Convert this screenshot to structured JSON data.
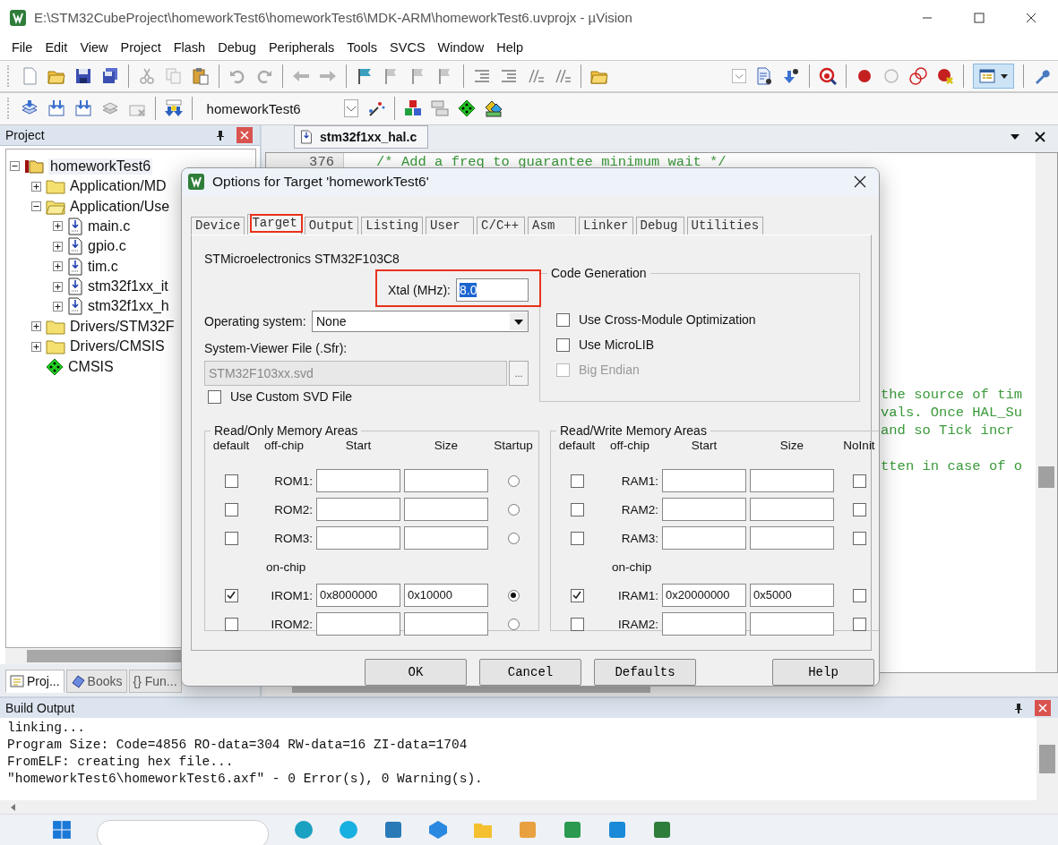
{
  "window": {
    "title": "E:\\STM32CubeProject\\homeworkTest6\\homeworkTest6\\MDK-ARM\\homeworkTest6.uvprojx - µVision"
  },
  "menu": [
    "File",
    "Edit",
    "View",
    "Project",
    "Flash",
    "Debug",
    "Peripherals",
    "Tools",
    "SVCS",
    "Window",
    "Help"
  ],
  "target_select": {
    "value": "homeworkTest6"
  },
  "project": {
    "title": "Project",
    "tree": [
      {
        "label": "homeworkTest6",
        "kind": "project",
        "expanded": true,
        "selected": true,
        "children": [
          {
            "label": "Application/MD",
            "kind": "folder",
            "expanded": false,
            "selected": false
          },
          {
            "label": "Application/Use",
            "kind": "folder",
            "expanded": true,
            "selected": false,
            "children": [
              {
                "label": "main.c",
                "kind": "file",
                "expanded": false,
                "selected": false
              },
              {
                "label": "gpio.c",
                "kind": "file",
                "expanded": false,
                "selected": false
              },
              {
                "label": "tim.c",
                "kind": "file",
                "expanded": false,
                "selected": false
              },
              {
                "label": "stm32f1xx_it",
                "kind": "file",
                "expanded": false,
                "selected": false
              },
              {
                "label": "stm32f1xx_h",
                "kind": "file",
                "expanded": false,
                "selected": false
              }
            ]
          },
          {
            "label": "Drivers/STM32F",
            "kind": "folder",
            "expanded": false,
            "selected": false
          },
          {
            "label": "Drivers/CMSIS",
            "kind": "folder",
            "expanded": false,
            "selected": false
          },
          {
            "label": "CMSIS",
            "kind": "component",
            "selected": false
          }
        ]
      }
    ],
    "tabs": [
      {
        "label": "Proj...",
        "kind": "project",
        "selected": true
      },
      {
        "label": "Books",
        "kind": "books",
        "selected": false
      },
      {
        "label": "{} Fun...",
        "kind": "functions",
        "selected": false
      }
    ]
  },
  "editor": {
    "tabs": [
      {
        "label": "stm32f1xx_hal.c",
        "selected": true
      }
    ],
    "lines": [
      {
        "number": "376",
        "code": "/* Add a freq to guarantee minimum wait */"
      }
    ],
    "fragments": [
      [
        "the source of tim",
        "vals. Once HAL_Su",
        "and so Tick incr"
      ],
      [
        "tten in case of o"
      ]
    ]
  },
  "dialog": {
    "title": "Options for Target 'homeworkTest6'",
    "tabs": [
      {
        "label": "Device",
        "selected": false,
        "highlight": false
      },
      {
        "label": "Target",
        "selected": true,
        "highlight": true
      },
      {
        "label": "Output",
        "selected": false,
        "highlight": false
      },
      {
        "label": "Listing",
        "selected": false,
        "highlight": false
      },
      {
        "label": "User",
        "selected": false,
        "highlight": false
      },
      {
        "label": "C/C++",
        "selected": false,
        "highlight": false
      },
      {
        "label": "Asm",
        "selected": false,
        "highlight": false
      },
      {
        "label": "Linker",
        "selected": false,
        "highlight": false
      },
      {
        "label": "Debug",
        "selected": false,
        "highlight": false
      },
      {
        "label": "Utilities",
        "selected": false,
        "highlight": false
      }
    ],
    "device": "STMicroelectronics STM32F103C8",
    "xtal": {
      "label": "Xtal (MHz):",
      "value": "8.0",
      "highlight": true
    },
    "os": {
      "label": "Operating system:",
      "value": "None"
    },
    "svd": {
      "label": "System-Viewer File (.Sfr):",
      "value": "STM32F103xx.svd",
      "browse": "...",
      "disabled": true
    },
    "custom_svd": {
      "label": "Use Custom SVD File",
      "checked": false
    },
    "code_generation": {
      "title": "Code Generation",
      "options": [
        {
          "label": "Use Cross-Module Optimization",
          "checked": false,
          "disabled": false
        },
        {
          "label": "Use MicroLIB",
          "checked": false,
          "disabled": false
        },
        {
          "label": "Big Endian",
          "checked": false,
          "disabled": true
        }
      ]
    },
    "memory": [
      {
        "title": "Read/Only Memory Areas",
        "headers": [
          "default",
          "off-chip",
          "Start",
          "Size",
          "Startup"
        ],
        "kind": "radio",
        "onchip_label": "on-chip",
        "offchip": [
          {
            "label": "ROM1:",
            "default": false,
            "last": false
          },
          {
            "label": "ROM2:",
            "default": false,
            "last": false
          },
          {
            "label": "ROM3:",
            "default": false,
            "last": false
          }
        ],
        "onchip": [
          {
            "label": "IROM1:",
            "default": true,
            "start": "0x8000000",
            "size": "0x10000",
            "last": true
          },
          {
            "label": "IROM2:",
            "default": false,
            "last": false
          }
        ]
      },
      {
        "title": "Read/Write Memory Areas",
        "headers": [
          "default",
          "off-chip",
          "Start",
          "Size",
          "NoInit"
        ],
        "kind": "checkbox",
        "onchip_label": "on-chip",
        "offchip": [
          {
            "label": "RAM1:",
            "default": false,
            "last": false
          },
          {
            "label": "RAM2:",
            "default": false,
            "last": false
          },
          {
            "label": "RAM3:",
            "default": false,
            "last": false
          }
        ],
        "onchip": [
          {
            "label": "IRAM1:",
            "default": true,
            "start": "0x20000000",
            "size": "0x5000",
            "last": false
          },
          {
            "label": "IRAM2:",
            "default": false,
            "last": false
          }
        ]
      }
    ],
    "buttons": [
      "OK",
      "Cancel",
      "Defaults",
      "Help"
    ]
  },
  "build_output": {
    "title": "Build Output",
    "lines": [
      "linking...",
      "Program Size: Code=4856 RO-data=304 RW-data=16 ZI-data=1704",
      "FromELF: creating hex file...",
      "\"homeworkTest6\\homeworkTest6.axf\" - 0 Error(s), 0 Warning(s)."
    ]
  }
}
